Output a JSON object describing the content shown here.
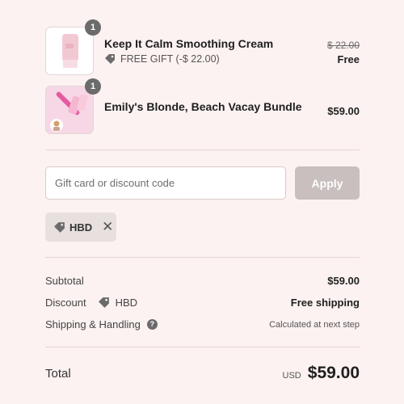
{
  "items": [
    {
      "qty": "1",
      "name": "Keep It Calm Smoothing Cream",
      "gift_label": "FREE GIFT (-$ 22.00)",
      "original_price": "$ 22.00",
      "price": "Free"
    },
    {
      "qty": "1",
      "name": "Emily's Blonde, Beach Vacay Bundle",
      "price": "$59.00"
    }
  ],
  "discount": {
    "placeholder": "Gift card or discount code",
    "apply_label": "Apply",
    "applied_code": "HBD"
  },
  "summary": {
    "subtotal_label": "Subtotal",
    "subtotal_value": "$59.00",
    "discount_label": "Discount",
    "discount_code": "HBD",
    "discount_value": "Free shipping",
    "shipping_label": "Shipping & Handling",
    "shipping_value": "Calculated at next step",
    "total_label": "Total",
    "currency": "USD",
    "total_value": "$59.00"
  },
  "colors": {
    "background": "#fcf2f1",
    "apply_button": "#c9bfbf",
    "qty_badge": "#6b6b6b"
  }
}
